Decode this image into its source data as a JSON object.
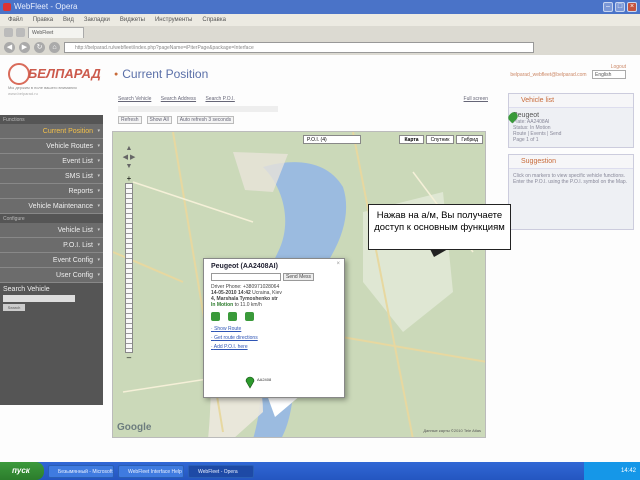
{
  "window": {
    "title": "WebFleet - Opera",
    "min": "–",
    "max": "□",
    "close": "×"
  },
  "menu": [
    "Файл",
    "Правка",
    "Вид",
    "Закладки",
    "Виджеты",
    "Инструменты",
    "Справка"
  ],
  "browser": {
    "tab": "WebFleet",
    "address": "http://belparad.ru/webfleet/index.php?pageName=iPiterPage&package=Interface"
  },
  "header": {
    "logo": "БЕЛПАРАД",
    "tagline": "Мы держим в поле вашего внимания",
    "subtag": "www.belparad.ru",
    "page_title": "Current Position",
    "user_email": "belparad_webfleet@belparad.com",
    "logout": "Logout",
    "language": "English"
  },
  "sidebar": {
    "section1": "Functions",
    "items1": [
      "Current Position",
      "Vehicle Routes",
      "Event List",
      "SMS List",
      "Reports",
      "Vehicle Maintenance"
    ],
    "section2": "Configure",
    "items2": [
      "Vehicle List",
      "P.O.I. List",
      "Event Config",
      "User Config"
    ],
    "search_label": "Search Vehicle",
    "search_button": "Search"
  },
  "searchbar": {
    "tabs": [
      "Search Vehicle",
      "Search Address",
      "Search P.O.I."
    ],
    "full_screen": "Full screen",
    "buttons": [
      "Refresh",
      "Show All",
      "Auto refresh 3 seconds"
    ]
  },
  "map": {
    "types": [
      "Карта",
      "Спутник",
      "Гибрид"
    ],
    "poi": "P.O.I. (4)",
    "copyright": "Данные карты ©2010 Tele Atlas",
    "logo": "Google",
    "pan": [
      "▲",
      "◀ ▶",
      "▼"
    ],
    "zoom_in": "+",
    "zoom_out": "–",
    "marker_label": "AA2408"
  },
  "popup": {
    "title": "Peugeot (AA2408AI)",
    "send_button": "Send Mess",
    "driver_phone": "Driver Phone: +380971028064",
    "datetime": "14-05-2010 14:42",
    "place": "Ucraina, Kiev",
    "street": "4, Marshala Tymoshenko str",
    "motion_label": "In Motion",
    "motion_to": "to 11.0 km/h",
    "links": [
      "Show Route",
      "Get route directions",
      "Add P.O.I. here"
    ],
    "close": "×"
  },
  "rpanel": {
    "list_title": "Vehicle list",
    "vehicle_name": "Peugeot",
    "vehicle_plate": "Plate: AA2408AI",
    "vehicle_status": "Status: In Motion",
    "vehicle_links": "Route | Events | Send",
    "page": "Page 1 of 1",
    "suggestion_title": "Suggestion",
    "suggestion_text": "Click on markers to view specific vehicle functions. Enter the P.O.I. using the P.O.I. symbol on the Map."
  },
  "callout": "Нажав на а/м, Вы получаете доступ к основным функциям",
  "taskbar": {
    "start": "пуск",
    "tasks": [
      "Безымянный - Microsoft",
      "WebFleet Interface Help",
      "WebFleet - Opera"
    ],
    "clock": "14:42"
  },
  "colors": {
    "accent": "#c86b3a",
    "sidebar_bg": "#555555",
    "active_item": "#f3c04a"
  }
}
